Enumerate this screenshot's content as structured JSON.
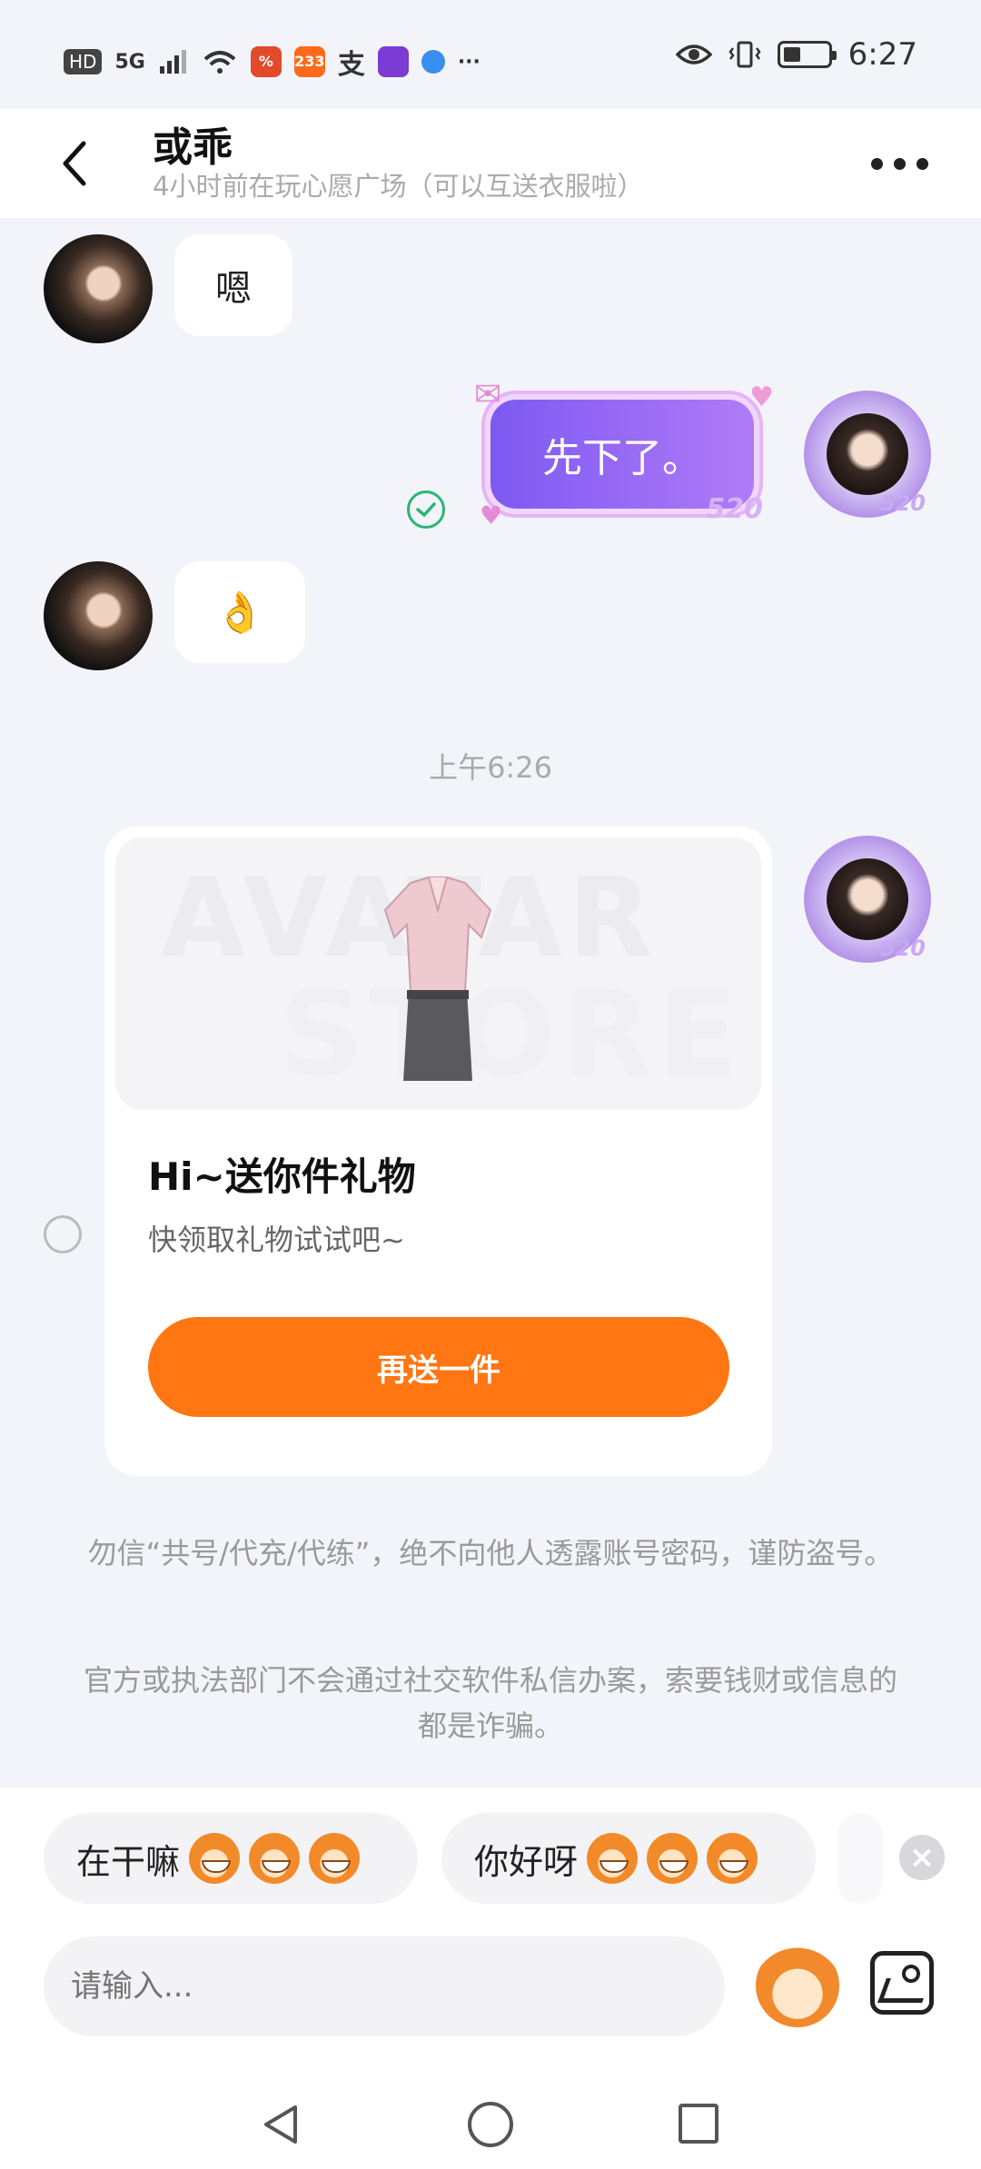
{
  "status_bar": {
    "left_tags": [
      "HD",
      "5G"
    ],
    "app_badge": "233",
    "app_char": "支",
    "more": "···",
    "time": "6:27"
  },
  "header": {
    "title": "或乖",
    "subtitle": "4小时前在玩心愿广场（可以互送衣服啦）"
  },
  "messages": {
    "msg1": "嗯",
    "msg2": "先下了。",
    "msg2_badge": "520",
    "msg3_emoji": "👌",
    "avatar_badge": "520",
    "timestamp": "上午6:26"
  },
  "gift_card": {
    "watermark_line1": "AVATAR",
    "watermark_line2": "STORE",
    "title": "Hi~送你件礼物",
    "description": "快领取礼物试试吧~",
    "button_label": "再送一件"
  },
  "notices": {
    "notice1": "勿信“共号/代充/代练”，绝不向他人透露账号密码，谨防盗号。",
    "notice2": "官方或执法部门不会通过社交软件私信办案，索要钱财或信息的都是诈骗。"
  },
  "quick_replies": [
    {
      "label": "在干嘛"
    },
    {
      "label": "你好呀"
    }
  ],
  "input": {
    "placeholder": "请输入..."
  },
  "colors": {
    "accent": "#ff7612",
    "background": "#f3f4f9",
    "bubble_purple": "#7d59f2",
    "read_check": "#2bb673"
  }
}
